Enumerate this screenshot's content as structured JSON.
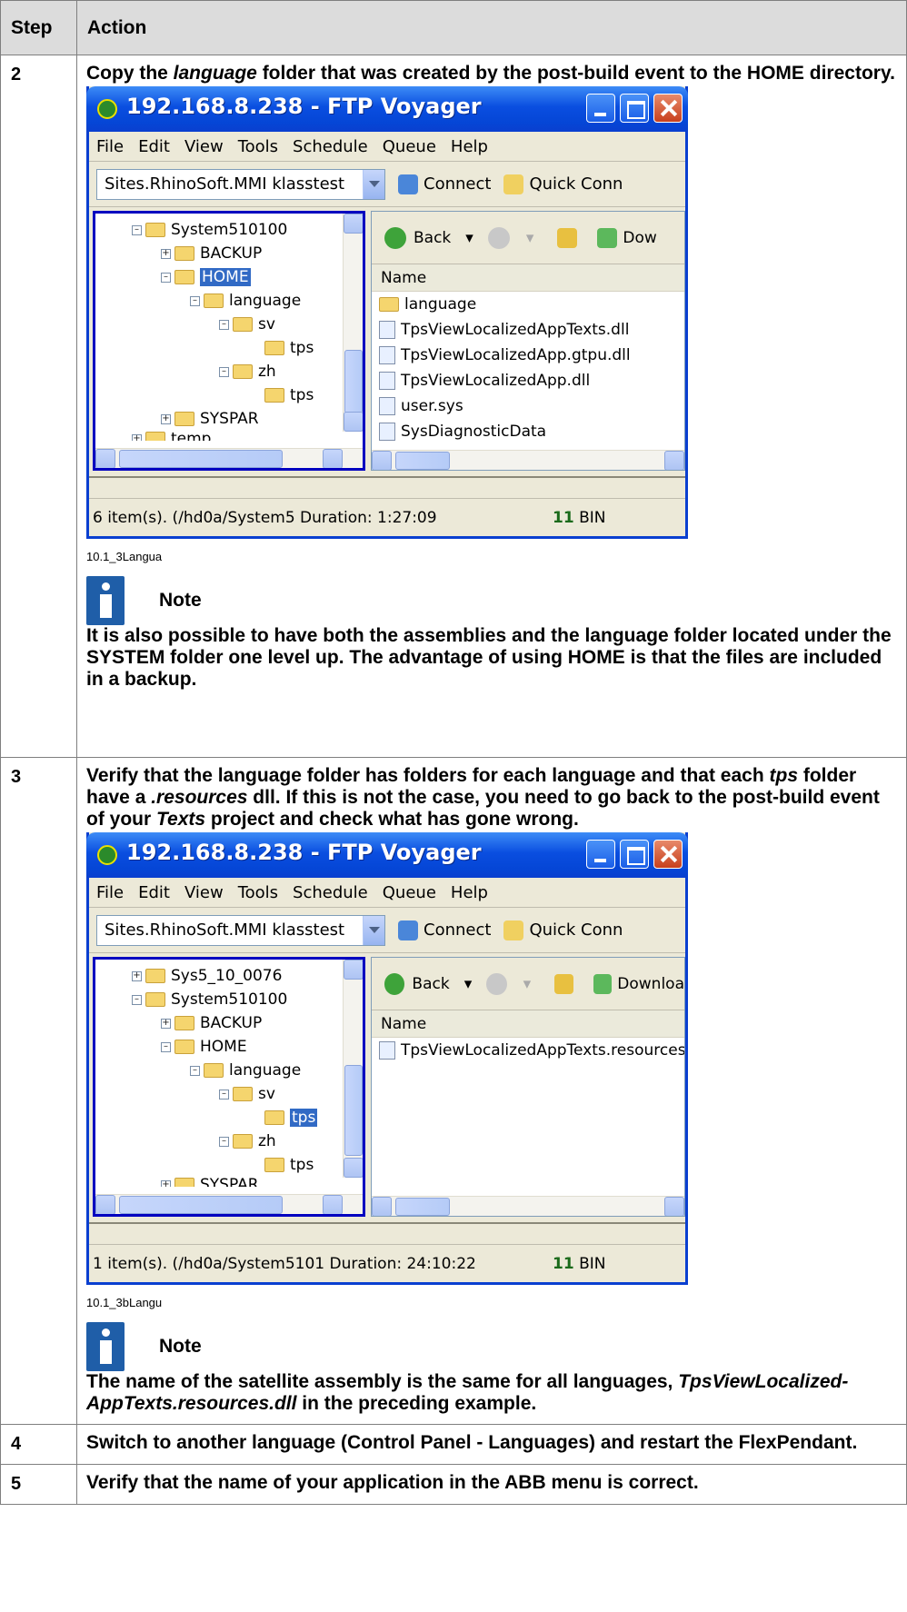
{
  "table": {
    "headers": [
      "Step",
      "Action"
    ],
    "rows": [
      {
        "step": "2",
        "text_parts": [
          "Copy the ",
          "language",
          " folder that was created by the post-build event to the HOME directory."
        ],
        "window": {
          "title": "192.168.8.238 - FTP Voyager",
          "menu": [
            "File",
            "Edit",
            "View",
            "Tools",
            "Schedule",
            "Queue",
            "Help"
          ],
          "site": "Sites.RhinoSoft.MMI klasstest",
          "connect": "Connect",
          "quick": "Quick Conn",
          "back": "Back",
          "download": "Dow",
          "tree": [
            "System510100",
            "BACKUP",
            "HOME",
            "language",
            "sv",
            "tps",
            "zh",
            "tps",
            "SYSPAR",
            "temp"
          ],
          "column": "Name",
          "files": [
            "language",
            "TpsViewLocalizedAppTexts.dll",
            "TpsViewLocalizedApp.gtpu.dll",
            "TpsViewLocalizedApp.dll",
            "user.sys",
            "SysDiagnosticData"
          ],
          "status": "6 item(s).  (/hd0a/System5 Duration: 1:27:09",
          "bin": "BIN"
        },
        "caption": "10.1_3Langua",
        "note_label": "Note",
        "note": "It is also possible to have both the assemblies and the language folder located under the SYSTEM folder one level up. The advantage of using HOME is that the files are included in a backup."
      },
      {
        "step": "3",
        "text_parts": [
          "Verify that the language folder has folders for each language and that each ",
          "tps",
          " folder have a ",
          ".resources",
          " dll. If this is not the case, you need to go back to the post-build event of your ",
          "Texts",
          " project and check what has gone wrong."
        ],
        "window": {
          "title": "192.168.8.238 - FTP Voyager",
          "menu": [
            "File",
            "Edit",
            "View",
            "Tools",
            "Schedule",
            "Queue",
            "Help"
          ],
          "site": "Sites.RhinoSoft.MMI klasstest",
          "connect": "Connect",
          "quick": "Quick Conn",
          "back": "Back",
          "download": "Downloa",
          "tree": [
            "Sys5_10_0076",
            "System510100",
            "BACKUP",
            "HOME",
            "language",
            "sv",
            "tps",
            "zh",
            "tps",
            "SYSPAR"
          ],
          "column": "Name",
          "files": [
            "TpsViewLocalizedAppTexts.resources.dll"
          ],
          "status": "1 item(s).  (/hd0a/System5101 Duration: 24:10:22",
          "bin": "BIN"
        },
        "caption": "10.1_3bLangu",
        "note_label": "Note",
        "note_parts": [
          "The name of the satellite assembly is the same for all languages, ",
          "TpsViewLocalized-AppTexts.resources.dll",
          " in the preceding example."
        ]
      },
      {
        "step": "4",
        "text": "Switch to another language (Control Panel - Languages) and restart the FlexPendant."
      },
      {
        "step": "5",
        "text": "Verify that the name of your application in the ABB menu is correct."
      }
    ]
  },
  "colors": {
    "header_bg": "#dcdcdc",
    "xp_title": "#0a4ee0",
    "note_icon": "#1f5ea8"
  }
}
